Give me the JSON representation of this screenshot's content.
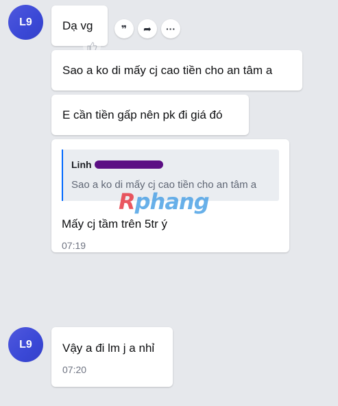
{
  "colors": {
    "background": "#e6e8ec",
    "avatar": "#3f4bd8",
    "quote_border": "#0068ff",
    "redaction": "#5c0f84"
  },
  "messages": [
    {
      "avatar_text": "L9",
      "bubbles": [
        {
          "text": "Dạ vg"
        },
        {
          "text": "Sao a ko di mấy cj cao tiền cho an tâm a"
        },
        {
          "text": "E cần tiền gấp nên pk đi giá đó"
        },
        {
          "quote": {
            "name": "Linh",
            "text": "Sao a ko di mấy cj cao tiền cho an tâm a"
          },
          "text": "Mấy cj tầm trên 5tr ý",
          "time": "07:19"
        }
      ]
    },
    {
      "avatar_text": "L9",
      "bubbles": [
        {
          "text": "Vậy a đi lm j a nhỉ",
          "time": "07:20"
        }
      ]
    }
  ],
  "actions": [
    {
      "icon": "quote-icon",
      "glyph": "❞"
    },
    {
      "icon": "share-icon",
      "glyph": "➦"
    },
    {
      "icon": "more-icon",
      "glyph": "···"
    }
  ],
  "like_icon": "thumbs-up-icon",
  "watermark": {
    "prefix": "R",
    "text": "phang"
  }
}
